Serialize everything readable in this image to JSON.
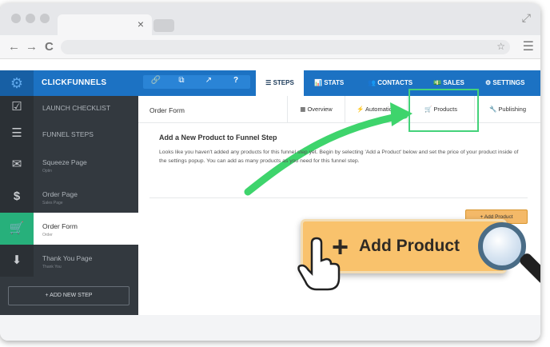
{
  "browser": {
    "tab_close": "×",
    "nav": {
      "back": "←",
      "forward": "→",
      "reload": "C"
    },
    "star": "☆",
    "menu": "☰",
    "expand": "⤢"
  },
  "app": {
    "brand": "CLICKFUNNELS",
    "toolbar_icons": [
      "🔗",
      "⧉",
      "↗",
      "?"
    ],
    "nav_tabs": [
      {
        "label": "STEPS",
        "icon": "☰"
      },
      {
        "label": "STATS",
        "icon": "📊"
      },
      {
        "label": "CONTACTS",
        "icon": "👥"
      },
      {
        "label": "SALES",
        "icon": "💵"
      },
      {
        "label": "SETTINGS",
        "icon": "⚙"
      }
    ],
    "sidebar": {
      "launch_checklist": "LAUNCH CHECKLIST",
      "funnel_steps": "FUNNEL STEPS",
      "steps": [
        {
          "name": "Squeeze Page",
          "sub": "Optin",
          "icon": "✉"
        },
        {
          "name": "Order Page",
          "sub": "Sales Page",
          "icon": "$"
        },
        {
          "name": "Order Form",
          "sub": "Order",
          "icon": "🛒"
        },
        {
          "name": "Thank You Page",
          "sub": "Thank You",
          "icon": "⬇"
        }
      ],
      "add_new_step": "+   ADD NEW STEP"
    },
    "main": {
      "title": "Order Form",
      "subtabs": [
        {
          "label": "Overview",
          "icon": "▦"
        },
        {
          "label": "Automation",
          "icon": "⚡"
        },
        {
          "label": "Products",
          "icon": "🛒"
        },
        {
          "label": "Publishing",
          "icon": "🔧"
        }
      ],
      "panel_title": "Add a New Product to Funnel Step",
      "panel_text": "Looks like you haven't added any products for this funnel step yet. Begin by selecting 'Add a Product' below and set the price of your product inside of the settings popup. You can add as many products as you need for this funnel step.",
      "small_add_button": "+ Add Product",
      "big_add_plus": "+",
      "big_add_label": "Add Product"
    }
  },
  "colors": {
    "topbar": "#1c72c3",
    "sidebar": "#33393f",
    "active_step": "#27b07b",
    "highlight_box": "#44d27a",
    "button": "#f9c26c"
  }
}
